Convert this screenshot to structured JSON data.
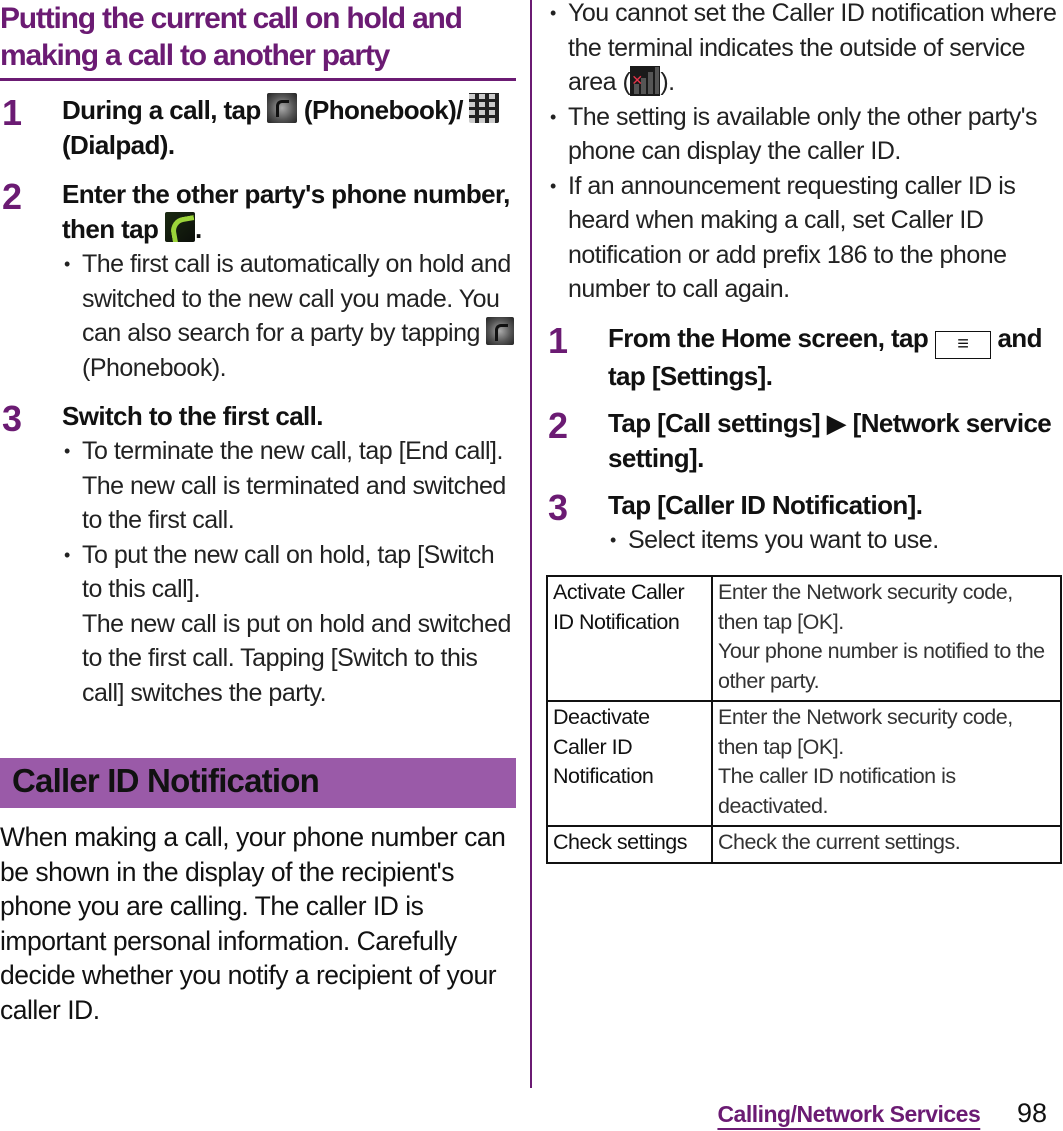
{
  "left": {
    "title": "Putting the current call on hold and making a call to another party",
    "steps": [
      {
        "num": "1",
        "text_parts": [
          "During a call, tap ",
          " (Phonebook)/ ",
          " (Dialpad)."
        ]
      },
      {
        "num": "2",
        "text_parts": [
          "Enter the other party's phone number, then tap ",
          "."
        ],
        "bullets": [
          {
            "part1": "The first call is automatically on hold and switched to the new call you made. You can also search for a party by tapping ",
            "part2": " (Phonebook)."
          }
        ]
      },
      {
        "num": "3",
        "text": "Switch to the first call.",
        "bullets": [
          {
            "line1": "To terminate the new call, tap [End call].",
            "line2": "The new call is terminated and switched to the first call."
          },
          {
            "line1": "To put the new call on hold, tap [Switch to this call].",
            "line2": "The new call is put on hold and switched to the first call. Tapping [Switch to this call] switches the party."
          }
        ]
      }
    ],
    "section_heading": "Caller ID Notification",
    "intro": "When making a call, your phone number can be shown in the display of the recipient's phone you are calling. The caller ID is important personal information. Carefully decide whether you notify a recipient of your caller ID."
  },
  "right": {
    "notes": [
      {
        "part1": "You cannot set the Caller ID notification where the terminal indicates the outside of service area (",
        "part2": ")."
      },
      {
        "text": "The setting is available only the other party's phone can display the caller ID."
      },
      {
        "text": "If an announcement requesting caller ID is heard when making a call, set Caller ID notification or add prefix 186 to the phone number to call again."
      }
    ],
    "steps": [
      {
        "num": "1",
        "text_parts": [
          "From the Home screen, tap ",
          " and tap [Settings]."
        ],
        "key_glyph": "≡"
      },
      {
        "num": "2",
        "text": "Tap [Call settings] ▶ [Network service setting]."
      },
      {
        "num": "3",
        "text": "Tap [Caller ID Notification].",
        "bullet": "Select items you want to use."
      }
    ],
    "table": [
      {
        "option": "Activate Caller ID Notification",
        "desc1": "Enter the Network security code, then tap [OK].",
        "desc2": "Your phone number is notified to the other party."
      },
      {
        "option": "Deactivate Caller ID Notification",
        "desc1": "Enter the Network security code, then tap [OK].",
        "desc2": "The caller ID notification is deactivated."
      },
      {
        "option": "Check settings",
        "desc1": "Check the current settings."
      }
    ]
  },
  "footer": {
    "section": "Calling/Network Services",
    "page": "98"
  },
  "icons": {
    "phonebook": "phonebook-icon",
    "dialpad": "dialpad-icon",
    "call": "call-icon",
    "out_of_service": "out-of-service-signal-icon",
    "menu_key": "menu-key-icon"
  },
  "colors": {
    "accent": "#6b1b73",
    "section_bar": "#9a5aa8",
    "call_icon_green": "#9bd43a",
    "out_of_service_red": "#e8344a"
  }
}
